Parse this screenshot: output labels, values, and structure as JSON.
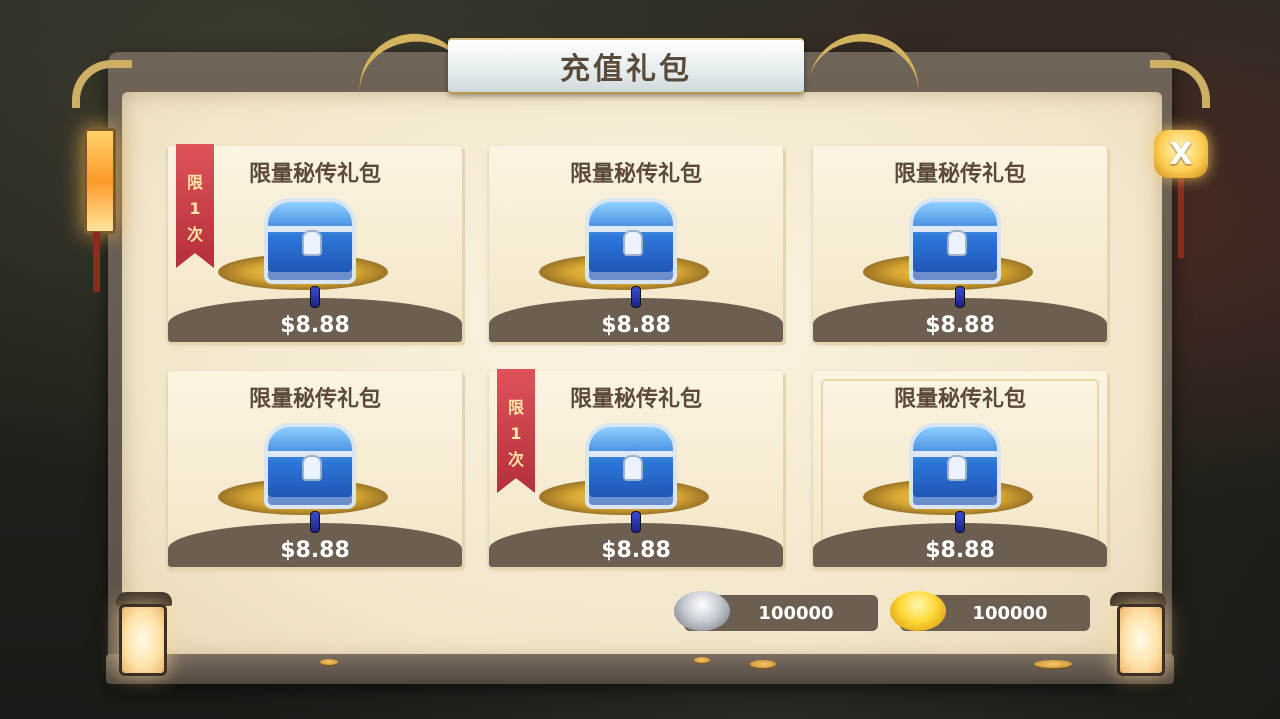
{
  "title": "充值礼包",
  "close_label": "X",
  "cards": [
    {
      "name": "限量秘传礼包",
      "price": "$8.88",
      "limit": [
        "限",
        "1",
        "次"
      ]
    },
    {
      "name": "限量秘传礼包",
      "price": "$8.88"
    },
    {
      "name": "限量秘传礼包",
      "price": "$8.88"
    },
    {
      "name": "限量秘传礼包",
      "price": "$8.88"
    },
    {
      "name": "限量秘传礼包",
      "price": "$8.88",
      "limit": [
        "限",
        "1",
        "次"
      ]
    },
    {
      "name": "限量秘传礼包",
      "price": "$8.88"
    }
  ],
  "currency": {
    "silver": "100000",
    "gold": "100000"
  },
  "icons": {
    "chest": "treasure-chest-icon",
    "silver": "silver-ingot-icon",
    "gold": "gold-ingot-icon",
    "close": "close-icon"
  },
  "colors": {
    "panel": "#f3e5c6",
    "price_bar": "#6c5e51",
    "ribbon": "#c23a44",
    "title_text": "#5a4a3a"
  }
}
